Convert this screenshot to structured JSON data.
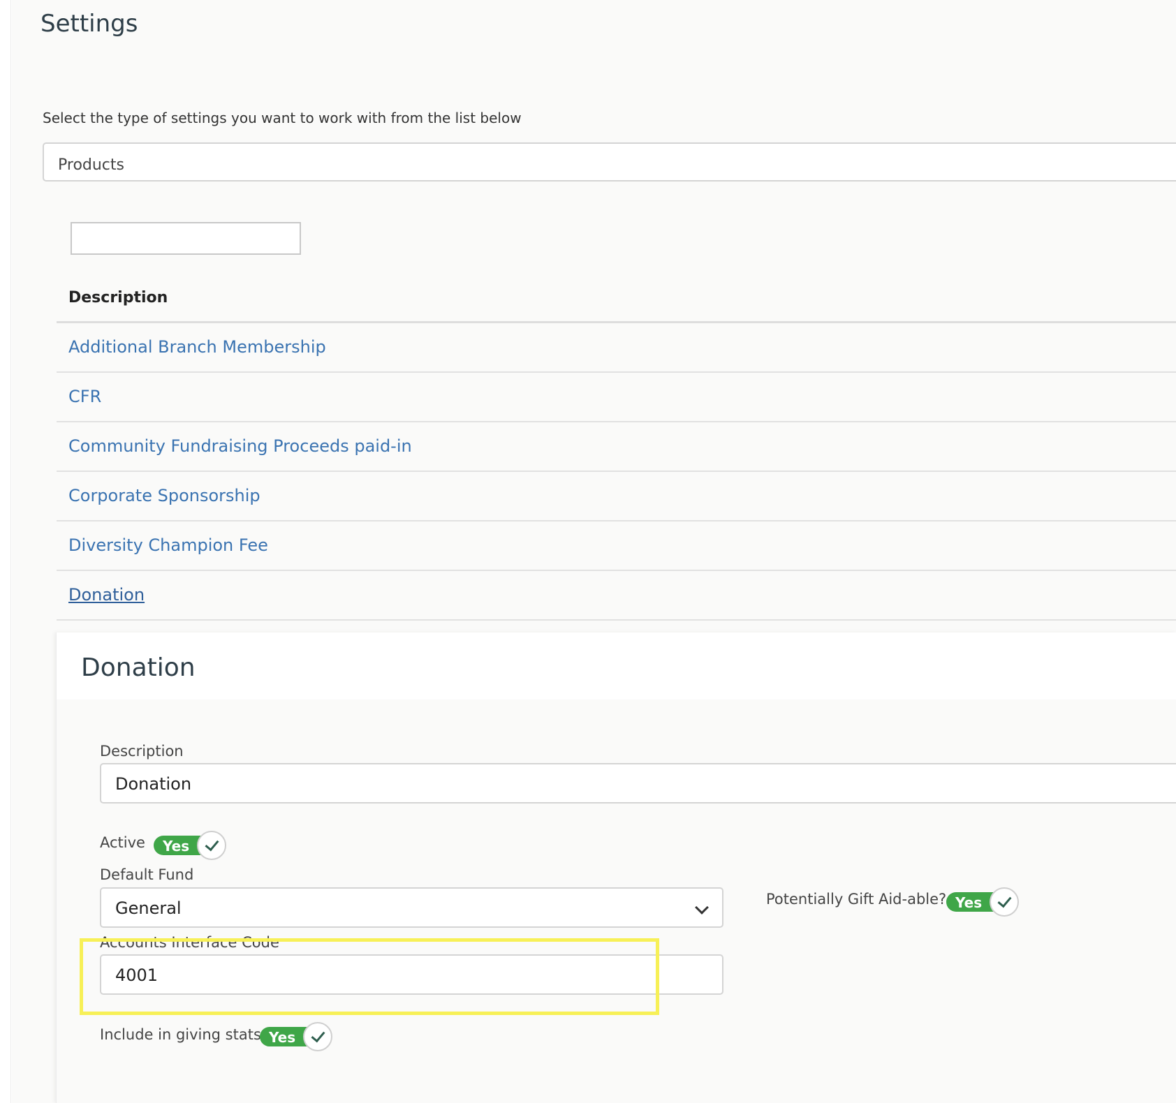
{
  "header": {
    "title": "Settings"
  },
  "settings_type": {
    "instruction": "Select the type of settings you want to work with from the list below",
    "selected": "Products"
  },
  "filter": {
    "value": ""
  },
  "table": {
    "column_header": "Description",
    "rows": [
      "Additional Branch Membership",
      "CFR",
      "Community Fundraising Proceeds paid-in",
      "Corporate Sponsorship",
      "Diversity Champion Fee",
      "Donation"
    ],
    "selected_row": "Donation"
  },
  "detail": {
    "title": "Donation",
    "description_label": "Description",
    "description_value": "Donation",
    "active_label": "Active",
    "active_toggle": "Yes",
    "default_fund_label": "Default Fund",
    "default_fund_value": "General",
    "gift_aid_label": "Potentially Gift Aid-able?",
    "gift_aid_toggle": "Yes",
    "accounts_code_label": "Accounts Interface Code",
    "accounts_code_value": "4001",
    "giving_stats_label": "Include in giving stats",
    "giving_stats_toggle": "Yes"
  },
  "colors": {
    "link": "#3a73b1",
    "toggle_on": "#3fa648",
    "highlight": "#f7f057"
  },
  "icons": {
    "dropdown": "chevron-down-icon",
    "toggle_check": "check-icon"
  }
}
